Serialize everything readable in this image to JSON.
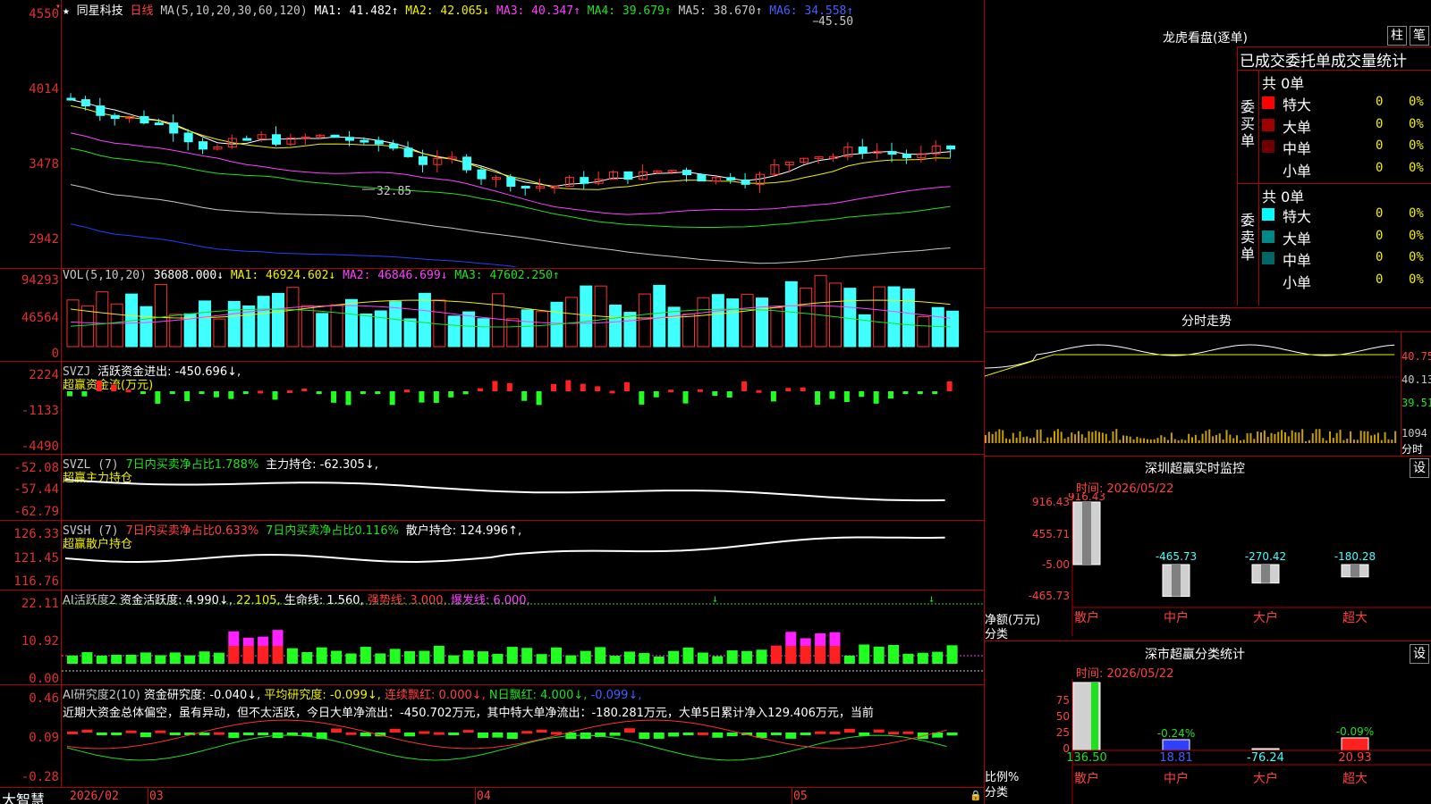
{
  "stock": {
    "star": "★",
    "name": "同星科技",
    "period": "日线"
  },
  "main": {
    "ma_caption": "MA(5,10,20,30,60,120)",
    "ma": [
      {
        "label": "MA1: 41.482↑",
        "color": "#ffffff"
      },
      {
        "label": "MA2: 42.065↓",
        "color": "#f0f000"
      },
      {
        "label": "MA3: 40.347↑",
        "color": "#ff40ff"
      },
      {
        "label": "MA4: 39.679↑",
        "color": "#20e020"
      },
      {
        "label": "MA5: 38.670↑",
        "color": "#c8c8c8"
      },
      {
        "label": "MA6: 34.558↑",
        "color": "#4060ff"
      }
    ],
    "y_ticks": [
      "4550",
      "4014",
      "3478",
      "2942"
    ],
    "high_mark": "45.50",
    "low_mark": "32.85"
  },
  "vol": {
    "caption": "VOL(5,10,20)",
    "value": "36808.000↓",
    "ma": [
      {
        "label": "MA1: 46924.602↓",
        "color": "#f0f000"
      },
      {
        "label": "MA2: 46846.699↓",
        "color": "#ff40ff"
      },
      {
        "label": "MA3: 47602.250↑",
        "color": "#20e020"
      }
    ],
    "y_ticks": [
      "94293",
      "46564",
      "0"
    ]
  },
  "svzj": {
    "caption": "SVZJ",
    "active": "活跃资金进出: -450.696↓,",
    "sub": "超赢资金流(万元)",
    "y_ticks": [
      "2224",
      "-1133",
      "-4490"
    ]
  },
  "svzl": {
    "caption": "SVZL (7)",
    "ratio": "7日内买卖净占比1.788%",
    "hold": "主力持仓: -62.305↓,",
    "sub": "超赢主力持仓",
    "y_ticks": [
      "-52.08",
      "-57.44",
      "-62.79"
    ]
  },
  "svsh": {
    "caption": "SVSH (7)",
    "ratio1": "7日内买卖净占比0.633%",
    "ratio2": "7日内买卖净占比0.116%",
    "hold": "散户持仓: 124.996↑,",
    "sub": "超赢散户持仓",
    "y_ticks": [
      "126.33",
      "121.45",
      "116.76"
    ]
  },
  "ai1": {
    "caption": "AI活跃度2",
    "fund": "资金活跃度: 4.990↓,",
    "v2": "22.105,",
    "life": "生命线: 1.560,",
    "strong": "强势线: 3.000,",
    "burst": "爆发线: 6.000,",
    "y_ticks": [
      "22.11",
      "10.92",
      "0.00"
    ]
  },
  "ai2": {
    "caption": "AI研究度2(10)",
    "fund": "资金研究度: -0.040↓,",
    "avg": "平均研究度: -0.099↓,",
    "red": "连续飘红: 0.000↓,",
    "nred": "N日飘红: 4.000↓,",
    "last": "-0.099↓,",
    "comment": "近期大资金总体偏空，虽有异动，但不太活跃，今日大单净流出：-450.702万元，其中特大单净流出：-180.281万元，大单5日累计净入129.406万元，当前",
    "y_ticks": [
      "0.46",
      "0.09",
      "-0.28"
    ]
  },
  "bottom": {
    "brand": "大智慧",
    "months": [
      "2026/02",
      "03",
      "04",
      "05"
    ]
  },
  "dragon": {
    "title": "龙虎看盘(逐单)",
    "btn1": "柱",
    "btn2": "笔",
    "header": "已成交委托单成交量统计",
    "buy_total": "共 0单",
    "buy_label": "委买单",
    "sell_total": "共 0单",
    "sell_label": "委卖单",
    "buy_rows": [
      {
        "label": "特大",
        "color": "#ff0000",
        "n": "0",
        "pct": "0%"
      },
      {
        "label": "大单",
        "color": "#a00000",
        "n": "0",
        "pct": "0%"
      },
      {
        "label": "中单",
        "color": "#700000",
        "n": "0",
        "pct": "0%"
      },
      {
        "label": "小单",
        "color": "",
        "n": "0",
        "pct": "0%"
      }
    ],
    "sell_rows": [
      {
        "label": "特大",
        "color": "#00ffff",
        "n": "0",
        "pct": "0%"
      },
      {
        "label": "大单",
        "color": "#008888",
        "n": "0",
        "pct": "0%"
      },
      {
        "label": "中单",
        "color": "#006666",
        "n": "0",
        "pct": "0%"
      },
      {
        "label": "小单",
        "color": "",
        "n": "0",
        "pct": "0%"
      }
    ]
  },
  "intraday": {
    "title": "分时走势",
    "p1": "40.75",
    "p2": "40.13",
    "p3": "39.51",
    "vol": "1094",
    "vol_label": "分时"
  },
  "monitor": {
    "title": "深圳超赢实时监控",
    "btn": "设",
    "time": "时间: 2026/05/22",
    "y_ticks": [
      "916.43",
      "455.71",
      "-5.00",
      "-465.73"
    ],
    "ylabel": "净额(万元)",
    "xlabel": "分类",
    "cats": [
      "散户",
      "中户",
      "大户",
      "超大"
    ],
    "values": [
      916.43,
      -465.73,
      -270.42,
      -180.28
    ],
    "labels": [
      "916.43",
      "-465.73",
      "-270.42",
      "-180.28"
    ]
  },
  "classify": {
    "title": "深市超赢分类统计",
    "btn": "设",
    "time": "时间: 2026/05/22",
    "y_ticks": [
      "75",
      "50",
      "25",
      "0"
    ],
    "ylabel": "比例%",
    "xlabel": "分类",
    "cats": [
      "散户",
      "中户",
      "大户",
      "超大"
    ],
    "top_labels": [
      "",
      "-0.24%",
      "",
      "-0.09%"
    ],
    "bottom_labels": [
      "136.50",
      "18.81",
      "-76.24",
      "20.93"
    ]
  }
}
